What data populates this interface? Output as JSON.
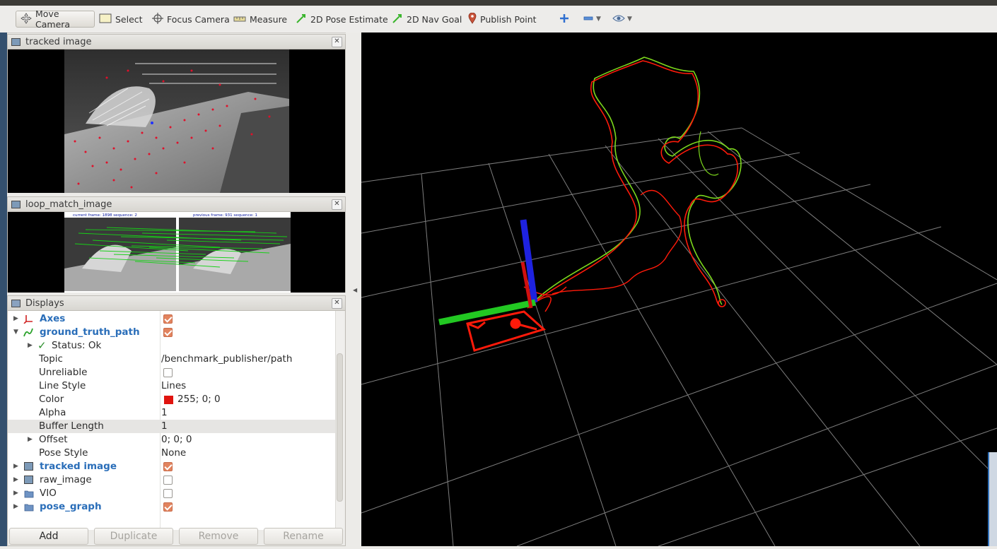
{
  "toolbar": {
    "move_camera": "Move Camera",
    "select": "Select",
    "focus_camera": "Focus Camera",
    "measure": "Measure",
    "pose_estimate": "2D Pose Estimate",
    "nav_goal": "2D Nav Goal",
    "publish_point": "Publish Point"
  },
  "panels": {
    "tracked_image_title": "tracked image",
    "loop_match_title": "loop_match_image",
    "loop_left_caption": "current frame: 1898  sequence: 2",
    "loop_right_caption": "previous frame: 931  sequence: 1",
    "displays_title": "Displays"
  },
  "displays": {
    "axes": "Axes",
    "ground_truth_path": "ground_truth_path",
    "status": "Status: Ok",
    "topic_label": "Topic",
    "topic_value": "/benchmark_publisher/path",
    "unreliable_label": "Unreliable",
    "line_style_label": "Line Style",
    "line_style_value": "Lines",
    "color_label": "Color",
    "color_value": "255; 0; 0",
    "color_swatch": "#e0140f",
    "alpha_label": "Alpha",
    "alpha_value": "1",
    "buffer_length_label": "Buffer Length",
    "buffer_length_value": "1",
    "offset_label": "Offset",
    "offset_value": "0; 0; 0",
    "pose_style_label": "Pose Style",
    "pose_style_value": "None",
    "tracked_image": "tracked image",
    "raw_image": "raw_image",
    "vio": "VIO",
    "pose_graph": "pose_graph"
  },
  "checks": {
    "axes": true,
    "ground_truth_path": true,
    "unreliable": false,
    "tracked_image": true,
    "raw_image": false,
    "vio": false,
    "pose_graph": true
  },
  "buttons": {
    "add": "Add",
    "duplicate": "Duplicate",
    "remove": "Remove",
    "rename": "Rename"
  },
  "colors": {
    "accent_blue": "#2a6eb9",
    "check_orange": "#e2845f",
    "path_red": "#ff1a0a",
    "path_green": "#7cd81c",
    "grid": "#8c8c8c"
  }
}
